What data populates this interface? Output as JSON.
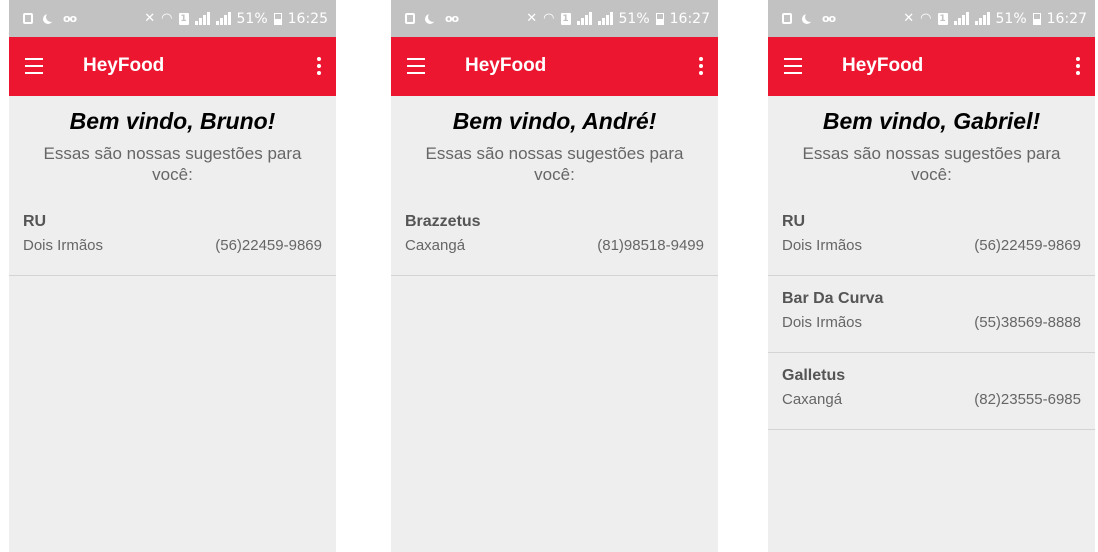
{
  "phones": [
    {
      "status": {
        "battery": "51%",
        "time": "16:25"
      },
      "appbar": {
        "title": "HeyFood"
      },
      "welcome": "Bem vindo, Bruno!",
      "subtitle": "Essas são nossas sugestões para você:",
      "items": [
        {
          "name": "RU",
          "area": "Dois Irmãos",
          "phone": "(56)22459-9869"
        }
      ]
    },
    {
      "status": {
        "battery": "51%",
        "time": "16:27"
      },
      "appbar": {
        "title": "HeyFood"
      },
      "welcome": "Bem vindo, André!",
      "subtitle": "Essas são nossas sugestões para você:",
      "items": [
        {
          "name": "Brazzetus",
          "area": "Caxangá",
          "phone": "(81)98518-9499"
        }
      ]
    },
    {
      "status": {
        "battery": "51%",
        "time": "16:27"
      },
      "appbar": {
        "title": "HeyFood"
      },
      "welcome": "Bem vindo, Gabriel!",
      "subtitle": "Essas são nossas sugestões para você:",
      "items": [
        {
          "name": "RU",
          "area": "Dois Irmãos",
          "phone": "(56)22459-9869"
        },
        {
          "name": "Bar Da Curva",
          "area": "Dois Irmãos",
          "phone": "(55)38569-8888"
        },
        {
          "name": "Galletus",
          "area": "Caxangá",
          "phone": "(82)23555-6985"
        }
      ]
    }
  ],
  "colors": {
    "appbar": "#ec1631",
    "statusbar": "#c2c2c2",
    "background": "#eeeeee"
  },
  "icons": {
    "menu": "hamburger-menu-icon",
    "more": "more-vertical-icon",
    "status": [
      "gallery-icon",
      "moon-icon",
      "voicemail-icon",
      "mute-icon",
      "wifi-icon",
      "sim-icon",
      "signal-icon",
      "signal-icon",
      "battery-icon"
    ]
  }
}
